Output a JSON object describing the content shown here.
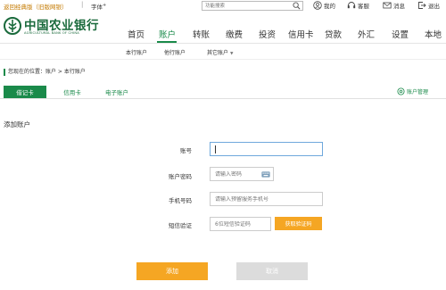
{
  "topbar": {
    "classic_link": "返回经典版（旧版网银）",
    "separator": "|",
    "font_label": "字体",
    "font_sup": "+",
    "search_placeholder": "功能搜索",
    "my_label": "我的",
    "service_label": "客服",
    "message_label": "消息",
    "logout_label": "退出"
  },
  "logo": {
    "name_cn": "中国农业银行",
    "name_en": "AGRICULTURAL BANK OF CHINA"
  },
  "nav": {
    "items": [
      "首页",
      "账户",
      "转账",
      "缴费",
      "投资",
      "信用卡",
      "贷款",
      "外汇",
      "设置",
      "本地"
    ],
    "active_index": 1
  },
  "subnav": {
    "items": [
      "本行账户",
      "他行账户",
      "其它账户"
    ],
    "dropdown_glyph": "▼"
  },
  "breadcrumb": "您现在的位置：账户 > 本行账户",
  "tabs": {
    "items": [
      "借记卡",
      "信用卡",
      "电子账户"
    ],
    "active_index": 0,
    "manage_label": "账户管理"
  },
  "section_title": "添加账户",
  "form": {
    "account_label": "账号",
    "account_value": "",
    "password_label": "账户密码",
    "password_placeholder": "请输入密码",
    "phone_label": "手机号码",
    "phone_placeholder": "请输入预留服务手机号",
    "sms_label": "短信验证",
    "sms_placeholder": "6位短信验证码",
    "get_code_label": "获取验证码"
  },
  "buttons": {
    "add_label": "添加",
    "back_label": "取消"
  },
  "colors": {
    "brand_green": "#1a8a4a",
    "accent_orange": "#f5a623",
    "disabled_gray": "#dcdcdc"
  }
}
